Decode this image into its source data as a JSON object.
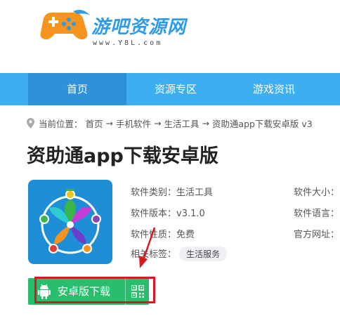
{
  "site": {
    "name": "游吧资源网",
    "url": "www.Y8L.com",
    "brand_blue": "#2f9be6",
    "brand_orange": "#f7941d"
  },
  "nav": {
    "items": [
      {
        "label": "首页",
        "active": true
      },
      {
        "label": "资源专区",
        "active": false
      },
      {
        "label": "游戏资讯",
        "active": false
      }
    ],
    "bg_color": "#3daef0",
    "active_color": "#2f92d9"
  },
  "breadcrumb": {
    "prefix": "当前位置：",
    "items": [
      "首页",
      "手机软件",
      "生活工具",
      "资助通app下载安卓版 v3"
    ],
    "separator": "→",
    "icon": "location-pin-icon"
  },
  "app": {
    "title": "资助通app下载安卓版",
    "icon": "app-logo-icon",
    "info": {
      "category_label": "软件类别：",
      "category_value": "生活工具",
      "version_label": "软件版本：",
      "version_value": "v3.1.0",
      "nature_label": "软件性质：",
      "nature_value": "免费",
      "tags_label": "相关标签：",
      "tag": "生活服务",
      "size_label": "软件大小：",
      "language_label": "软件语言：",
      "website_label": "官方网址："
    }
  },
  "download": {
    "label": "安卓版下载",
    "icon": "android-icon",
    "qr_icon": "qr-code-icon",
    "color": "#2bbd6e"
  },
  "annotation": {
    "color": "#d71920"
  }
}
